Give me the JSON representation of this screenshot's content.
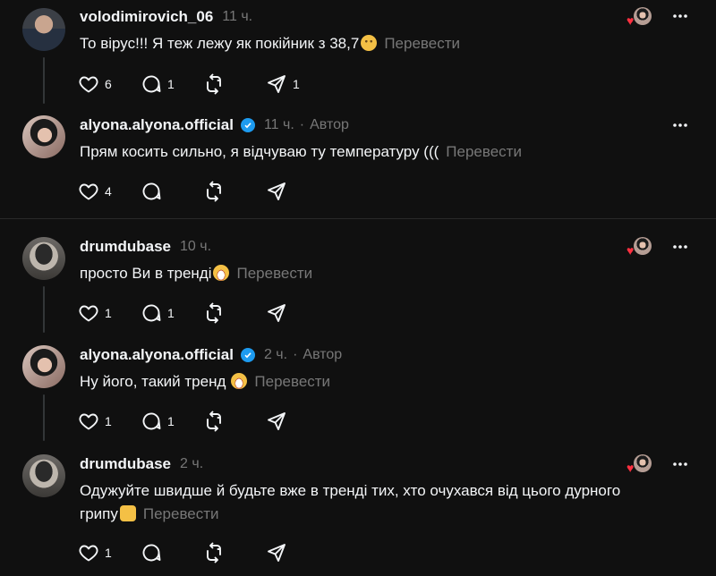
{
  "translate_label": "Перевести",
  "author_label": "Автор",
  "dot": "·",
  "threads": [
    {
      "username": "volodimirovich_06",
      "time": "11 ч.",
      "text": "То вірус!!! Я теж лежу як покійник з 38,7",
      "likes": "6",
      "replies": "1",
      "reposts": "",
      "shares": "1"
    },
    {
      "username": "alyona.alyona.official",
      "time": "11 ч.",
      "text": "Прям косить сильно, я відчуваю ту температуру (((",
      "likes": "4",
      "replies": "",
      "reposts": "",
      "shares": ""
    },
    {
      "username": "drumdubase",
      "time": "10 ч.",
      "text": "просто Ви в тренді",
      "likes": "1",
      "replies": "1",
      "reposts": "",
      "shares": ""
    },
    {
      "username": "alyona.alyona.official",
      "time": "2 ч.",
      "text": "Ну його, такий тренд",
      "likes": "1",
      "replies": "1",
      "reposts": "",
      "shares": ""
    },
    {
      "username": "drumdubase",
      "time": "2 ч.",
      "text_line1": "Одужуйте швидше й будьте вже в тренді тих, хто очухався від цього дурного",
      "text_line2": "грипу",
      "likes": "1",
      "replies": "",
      "reposts": "",
      "shares": ""
    }
  ],
  "colors": {
    "background": "#101010",
    "text": "#f3f5f7",
    "muted": "#777777",
    "verified": "#1d9bf0",
    "like": "#ff3040"
  },
  "icons": [
    "heart-icon",
    "comment-icon",
    "repost-icon",
    "share-icon",
    "more-icon",
    "verified-icon",
    "liked-by-author-icon"
  ]
}
